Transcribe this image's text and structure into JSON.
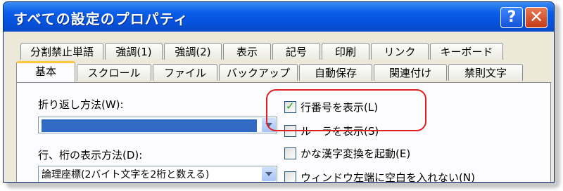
{
  "window": {
    "title": "すべての設定のプロパティ",
    "help_label": "?",
    "close_label": "✕"
  },
  "tabs_row1": [
    "分割禁止単語",
    "強調(1)",
    "強調(2)",
    "表示",
    "記号",
    "印刷",
    "リンク",
    "キーボード"
  ],
  "tabs_row2": [
    "基本",
    "スクロール",
    "ファイル",
    "バックアップ",
    "自動保存",
    "関連付け",
    "禁則文字"
  ],
  "active_tab": "基本",
  "wrap": {
    "label": "折り返し方法(W):",
    "value": ""
  },
  "rowcol": {
    "label": "行、桁の表示方法(D):",
    "value": "論理座標(2バイト文字を2桁と数える)"
  },
  "checkboxes": [
    {
      "label": "行番号を表示(L)",
      "checked": true
    },
    {
      "label": "ルーラを表示(S)",
      "checked": false
    },
    {
      "label": "かな漢字変換を起動(E)",
      "checked": false
    },
    {
      "label": "ウィンドウ左端に空白を入れない(N)",
      "checked": false
    }
  ],
  "colors": {
    "titlebar": "#0a5ee8",
    "selection": "#316ac5",
    "highlight": "#e02020"
  }
}
